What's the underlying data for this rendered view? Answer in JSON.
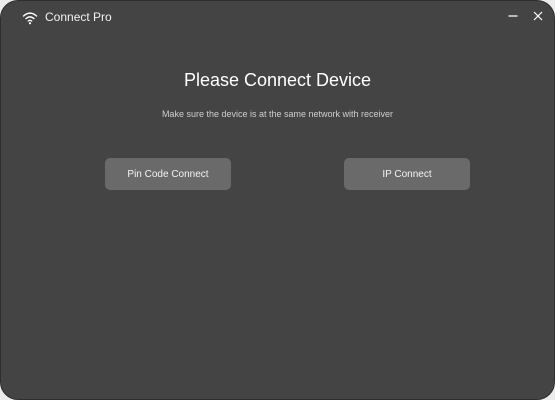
{
  "window": {
    "title": "Connect Pro",
    "app_icon": "wifi-icon",
    "minimize_icon": "minimize-icon",
    "close_icon": "close-icon"
  },
  "main": {
    "heading": "Please Connect Device",
    "subheading": "Make sure the device is at the same network with receiver",
    "buttons": [
      {
        "label": "Pin Code Connect"
      },
      {
        "label": "IP Connect"
      }
    ]
  },
  "colors": {
    "window_bg": "#444444",
    "button_bg": "#6a6a6a",
    "text": "#ffffff",
    "subtext": "#cfcfcf"
  }
}
